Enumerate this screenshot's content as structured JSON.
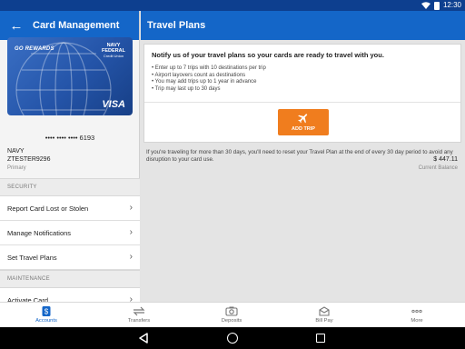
{
  "status_bar": {
    "time": "12:30"
  },
  "left_panel": {
    "title": "Card Management",
    "card": {
      "rewards_label": "GO REWARDS",
      "bank_line1": "NAVY",
      "bank_line2": "FEDERAL",
      "bank_line3": "Credit Union",
      "network": "VISA",
      "number_masked": "•••• •••• •••• 6193"
    },
    "account": {
      "name": "NAVY",
      "id": "ZTESTER9296",
      "balance": "$ 447.11",
      "type_label": "Primary",
      "balance_label": "Current Balance"
    },
    "sections": {
      "security": "SECURITY",
      "maintenance": "MAINTENANCE"
    },
    "menu": {
      "report_lost": "Report Card Lost or Stolen",
      "manage_notifications": "Manage Notifications",
      "set_travel_plans": "Set Travel Plans",
      "activate_card": "Activate Card"
    }
  },
  "right_panel": {
    "title": "Travel Plans",
    "info_title": "Notify us of your travel plans so your cards are ready to travel with you.",
    "info_items": [
      "Enter up to 7 trips with 10 destinations per trip",
      "Airport layovers count as destinations",
      "You may add trips up to 1 year in advance",
      "Trip may last up to 30 days"
    ],
    "add_trip_label": "ADD TRIP",
    "note": "If you're traveling for more than 30 days, you'll need to reset your Travel Plan at the end of every 30 day period to avoid any disruption to your card use."
  },
  "bottom_nav": {
    "items": [
      {
        "label": "Accounts",
        "badge": "$",
        "active": true
      },
      {
        "label": "Transfers"
      },
      {
        "label": "Deposits"
      },
      {
        "label": "Bill Pay"
      },
      {
        "label": "More"
      }
    ]
  },
  "colors": {
    "header": "#1466c8",
    "status_bar": "#0d3f8f",
    "accent": "#f07d1e"
  },
  "icons": [
    "back-arrow-icon",
    "wifi-icon",
    "battery-icon",
    "chevron-right-icon",
    "airplane-icon",
    "accounts-icon",
    "transfers-icon",
    "deposits-icon",
    "bill-pay-icon",
    "more-icon",
    "system-back-icon",
    "system-home-icon",
    "system-recents-icon"
  ]
}
